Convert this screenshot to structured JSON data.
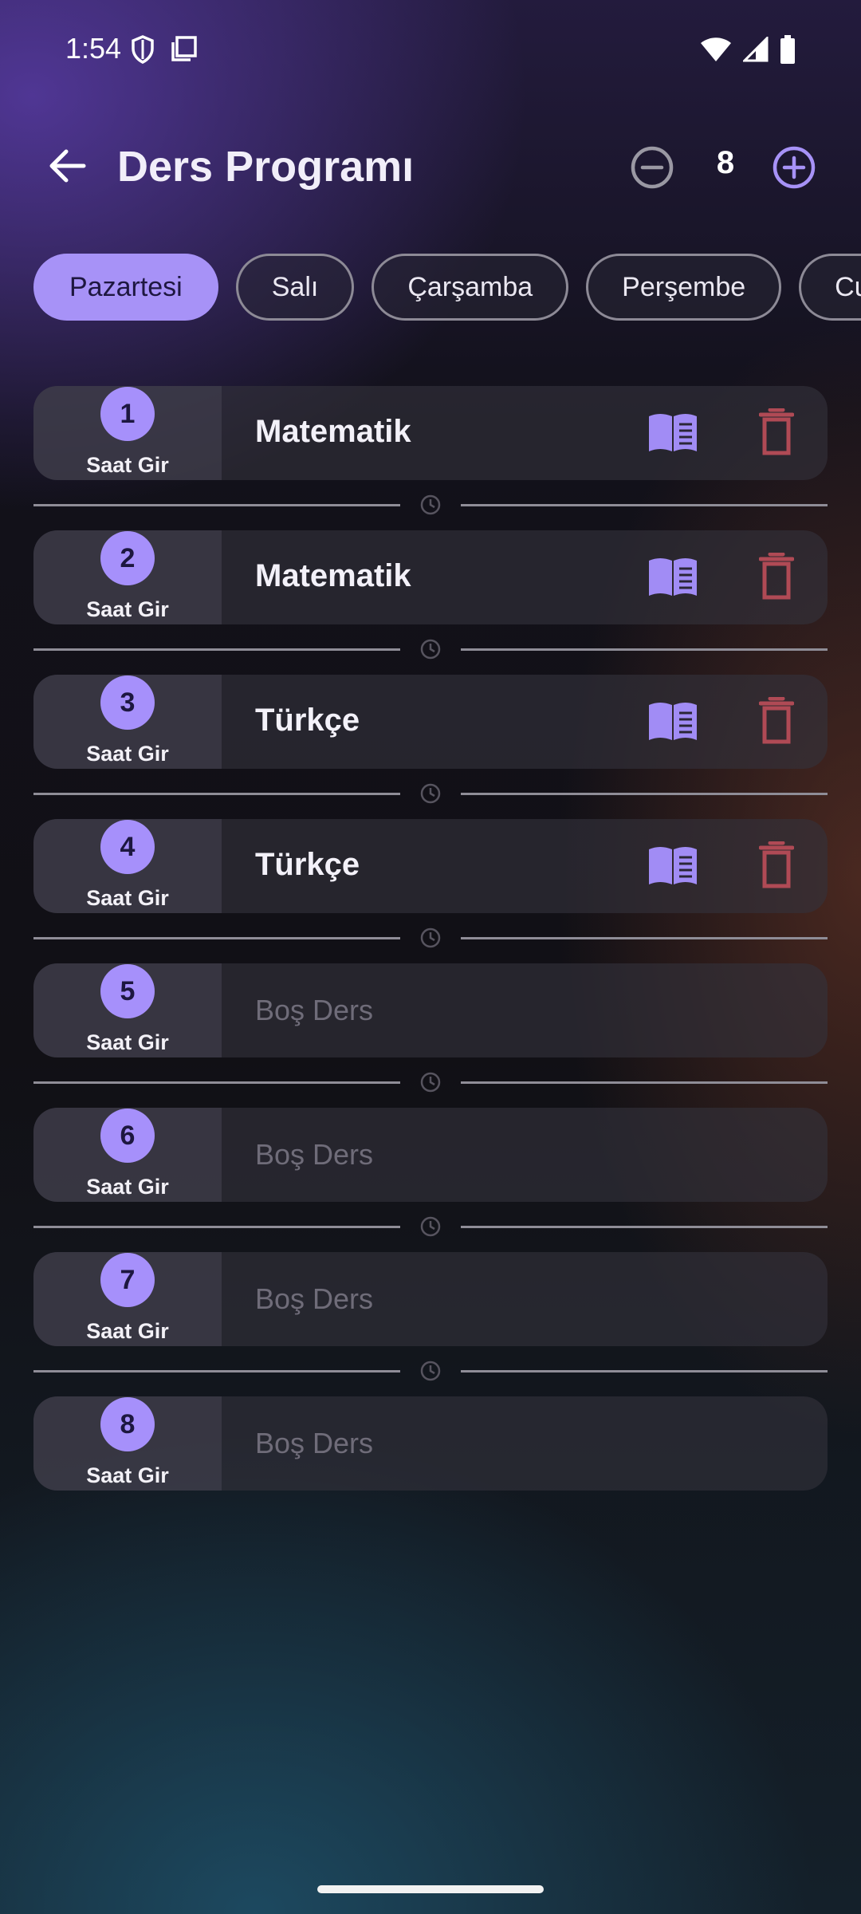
{
  "status_bar": {
    "time": "1:54",
    "icons": [
      "shield-icon",
      "screen-icon",
      "wifi-icon",
      "signal-icon",
      "battery-icon"
    ]
  },
  "header": {
    "title": "Ders Programı",
    "count": "8",
    "back_icon": "arrow-left-icon",
    "minus_icon": "minus-circle-icon",
    "plus_icon": "plus-circle-icon"
  },
  "tabs": [
    {
      "label": "Pazartesi",
      "active": true
    },
    {
      "label": "Salı",
      "active": false
    },
    {
      "label": "Çarşamba",
      "active": false
    },
    {
      "label": "Perşembe",
      "active": false
    },
    {
      "label": "Cuma",
      "active": false
    }
  ],
  "lessons": [
    {
      "number": "1",
      "time_label": "Saat Gir",
      "name": "Matematik",
      "empty": false
    },
    {
      "number": "2",
      "time_label": "Saat Gir",
      "name": "Matematik",
      "empty": false
    },
    {
      "number": "3",
      "time_label": "Saat Gir",
      "name": "Türkçe",
      "empty": false
    },
    {
      "number": "4",
      "time_label": "Saat Gir",
      "name": "Türkçe",
      "empty": false
    },
    {
      "number": "5",
      "time_label": "Saat Gir",
      "name": "Boş Ders",
      "empty": true
    },
    {
      "number": "6",
      "time_label": "Saat Gir",
      "name": "Boş Ders",
      "empty": true
    },
    {
      "number": "7",
      "time_label": "Saat Gir",
      "name": "Boş Ders",
      "empty": true
    },
    {
      "number": "8",
      "time_label": "Saat Gir",
      "name": "Boş Ders",
      "empty": true
    }
  ],
  "colors": {
    "accent": "#a792f7",
    "trash": "#b04a55",
    "book": "#a18cf5"
  }
}
